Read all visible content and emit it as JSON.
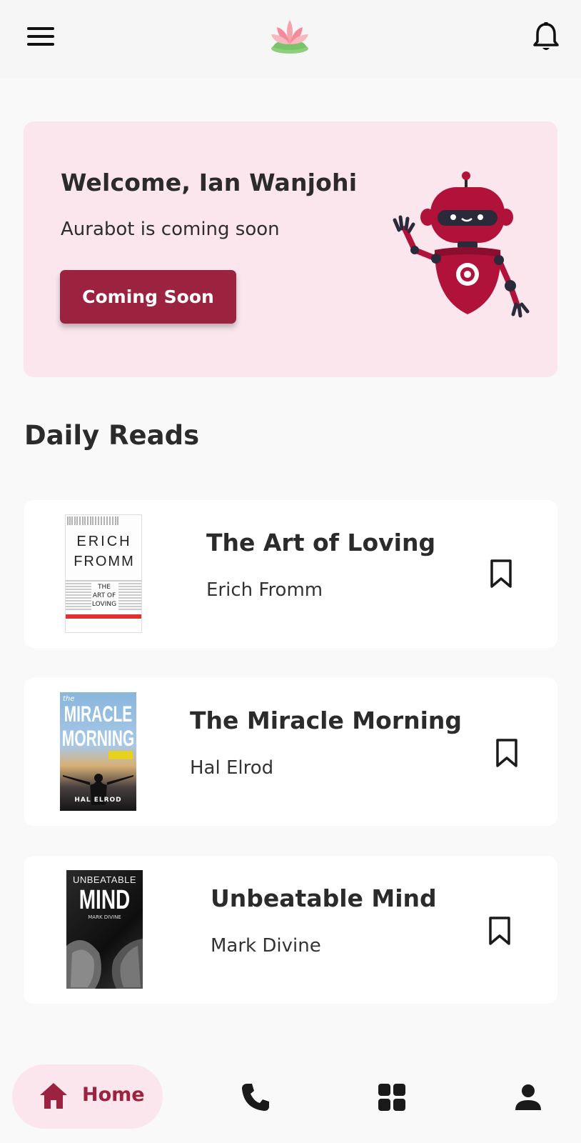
{
  "header": {
    "menu_icon": "hamburger-menu-icon",
    "logo_icon": "lotus-logo",
    "notification_icon": "bell-icon"
  },
  "welcome": {
    "title": "Welcome, Ian Wanjohi",
    "subtitle": "Aurabot is coming soon",
    "button_label": "Coming Soon",
    "illustration": "robot-waving-illustration"
  },
  "daily_reads": {
    "title": "Daily Reads",
    "books": [
      {
        "title": "The Art of Loving",
        "author": "Erich Fromm",
        "cover": {
          "author_line1": "ERICH",
          "author_line2": "FROMM",
          "title_line1": "THE",
          "title_line2": "ART OF",
          "title_line3": "LOVING"
        }
      },
      {
        "title": "The Miracle Morning",
        "author": "Hal Elrod",
        "cover": {
          "kicker": "the",
          "title_line1": "MIRACLE",
          "title_line2": "MORNING",
          "author": "HAL ELROD"
        }
      },
      {
        "title": "Unbeatable Mind",
        "author": "Mark Divine",
        "cover": {
          "title_line1": "UNBEATABLE",
          "title_line2": "MIND",
          "author": "MARK DIVINE"
        }
      }
    ]
  },
  "bottom_nav": {
    "home_label": "Home",
    "items": [
      "home-icon",
      "phone-icon",
      "grid-icon",
      "person-icon"
    ]
  },
  "colors": {
    "accent": "#9b2340",
    "banner_bg": "#fbe6ee",
    "page_bg": "#f9f9f9",
    "card_bg": "#ffffff"
  }
}
